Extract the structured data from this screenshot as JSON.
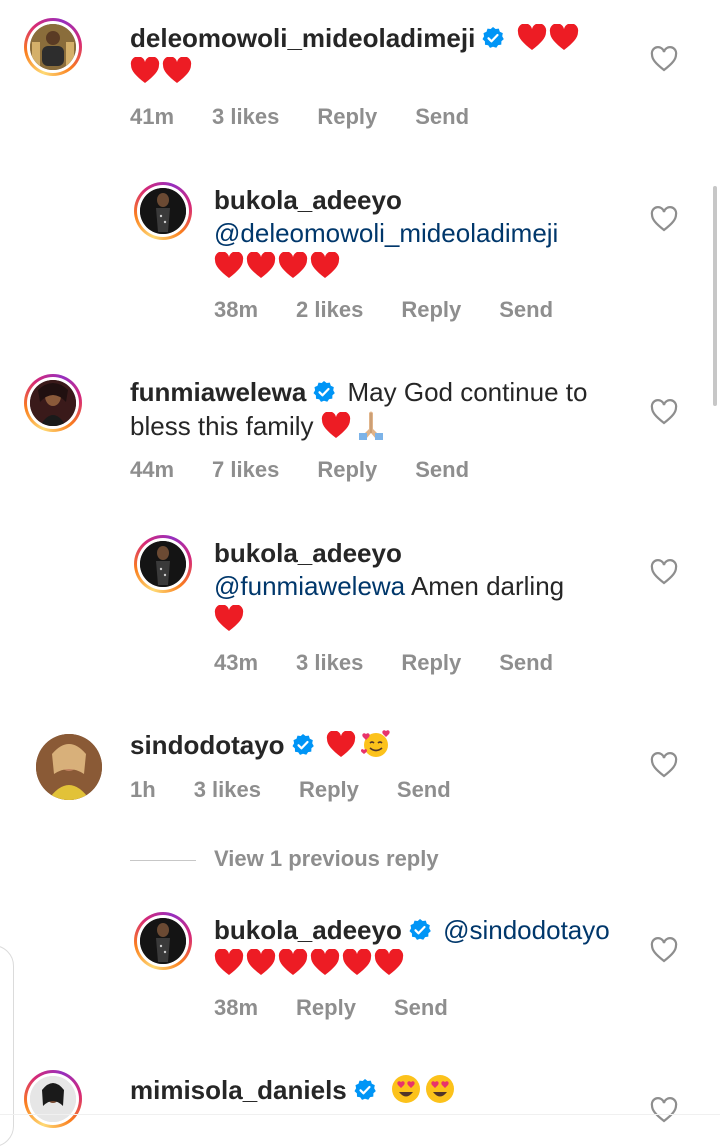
{
  "colors": {
    "text": "#262626",
    "meta": "#8e8e8e",
    "mention": "#00376b",
    "heart": "#ed1c24",
    "verified": "#0095f6"
  },
  "comments": [
    {
      "username": "deleomowoli_mideoladimeji",
      "verified": true,
      "text": "",
      "hearts": 4,
      "emojis": [],
      "time": "41m",
      "likes": "3 likes",
      "reply": "Reply",
      "send": "Send"
    },
    {
      "username": "bukola_adeeyo",
      "verified": false,
      "mention": "@deleomowoli_mideoladimeji",
      "hearts": 4,
      "time": "38m",
      "likes": "2 likes",
      "reply": "Reply",
      "send": "Send"
    },
    {
      "username": "funmiawelewa",
      "verified": true,
      "text_line1": "May God continue to",
      "text_line2": "bless this family",
      "hearts": 1,
      "emojis": [
        "folded-hands-emoji"
      ],
      "time": "44m",
      "likes": "7 likes",
      "reply": "Reply",
      "send": "Send"
    },
    {
      "username": "bukola_adeeyo",
      "verified": false,
      "mention": "@funmiawelewa",
      "text": "Amen darling",
      "hearts": 1,
      "time": "43m",
      "likes": "3 likes",
      "reply": "Reply",
      "send": "Send"
    },
    {
      "username": "sindodotayo",
      "verified": true,
      "hearts": 1,
      "emojis": [
        "smiling-face-with-hearts-emoji"
      ],
      "time": "1h",
      "likes": "3 likes",
      "reply": "Reply",
      "send": "Send"
    },
    {
      "username": "bukola_adeeyo",
      "verified": true,
      "mention": "@sindodotayo",
      "hearts": 6,
      "time": "38m",
      "reply": "Reply",
      "send": "Send"
    },
    {
      "username": "mimisola_daniels",
      "verified": true,
      "emojis": [
        "heart-eyes-emoji",
        "heart-eyes-emoji"
      ]
    }
  ],
  "view_previous": "View 1 previous reply"
}
